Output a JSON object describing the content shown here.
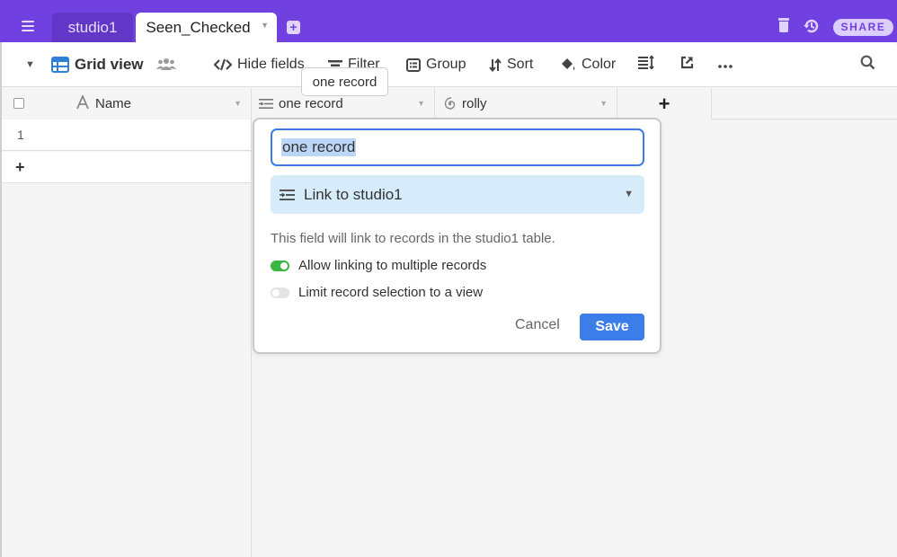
{
  "topbar": {
    "menu_icon": "hamburger-icon",
    "tabs": [
      {
        "label": "studio1",
        "active": false
      },
      {
        "label": "Seen_Checked",
        "active": true
      }
    ],
    "add_tab_icon": "plus-square-icon",
    "trash_icon": "trash-icon",
    "history_icon": "history-icon",
    "share_label": "SHARE",
    "accent_color": "#7140e0"
  },
  "toolbar": {
    "view_name": "Grid view",
    "items": [
      {
        "label": "Hide fields",
        "icon": "eye-slash-code-icon"
      },
      {
        "label": "Filter",
        "icon": "filter-icon"
      },
      {
        "label": "Group",
        "icon": "group-icon"
      },
      {
        "label": "Sort",
        "icon": "sort-icon"
      },
      {
        "label": "Color",
        "icon": "paint-bucket-icon"
      }
    ],
    "row_height_icon": "row-height-icon",
    "share_view_icon": "external-link-icon",
    "more_icon": "ellipsis-icon",
    "search_icon": "search-icon"
  },
  "tooltip": {
    "text": "one record"
  },
  "grid": {
    "columns": [
      {
        "label": "Name",
        "icon": "text-A-icon"
      },
      {
        "label": "one record",
        "icon": "link-icon"
      },
      {
        "label": "rolly",
        "icon": "rollup-spiral-icon"
      }
    ],
    "add_column_label": "+",
    "rows": [
      {
        "number": "1"
      }
    ],
    "add_row_label": "+"
  },
  "field_editor": {
    "name_value": "one record",
    "type_label": "Link to studio1",
    "description": "This field will link to records in the studio1 table.",
    "options": [
      {
        "label": "Allow linking to multiple records",
        "enabled": true
      },
      {
        "label": "Limit record selection to a view",
        "enabled": false
      }
    ],
    "cancel_label": "Cancel",
    "save_label": "Save",
    "save_color": "#3b7ee9",
    "toggle_on_color": "#39b542"
  }
}
